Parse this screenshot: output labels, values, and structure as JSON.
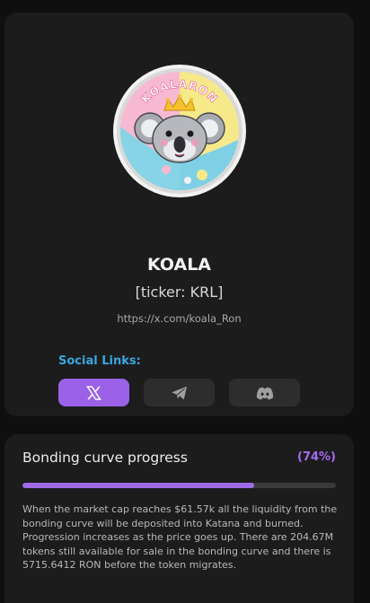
{
  "token": {
    "logo_text": "KOALARON",
    "name": "KOALA",
    "ticker_label": "[ticker: KRL]",
    "link": "https://x.com/koala_Ron"
  },
  "social": {
    "label": "Social Links:",
    "buttons": [
      {
        "name": "x",
        "icon": "x-icon",
        "active": true
      },
      {
        "name": "telegram",
        "icon": "telegram-icon",
        "active": false
      },
      {
        "name": "discord",
        "icon": "discord-icon",
        "active": false
      }
    ]
  },
  "bonding": {
    "title": "Bonding curve progress",
    "percent_label": "(74%)",
    "progress": 0.74,
    "description": "When the market cap reaches $61.57k all the liquidity from the bonding curve will be deposited into Katana and burned. Progression increases as the price goes up. There are 204.67M tokens still available for sale in the bonding curve and there is 5715.6412 RON before the token migrates."
  },
  "colors": {
    "accent": "#9b62e8",
    "social_label": "#3ba7e0",
    "card_bg": "#1c1c1d",
    "page_bg": "#0f0f10"
  }
}
